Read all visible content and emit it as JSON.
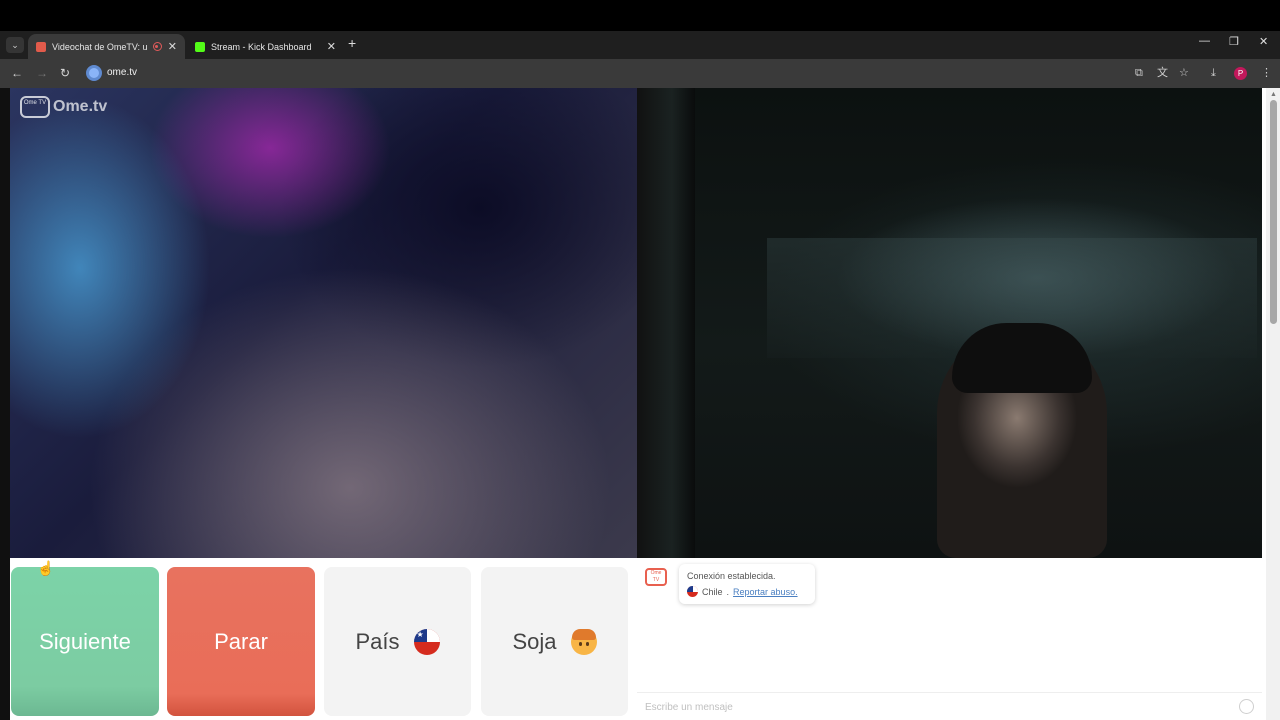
{
  "browser": {
    "tabs": [
      {
        "title": "Videochat de OmeTV: unu",
        "favicon_color": "#e25b4b",
        "recording": true,
        "active": true
      },
      {
        "title": "Stream - Kick Dashboard",
        "favicon_color": "#53fc18",
        "active": false
      }
    ],
    "url": "ome.tv",
    "profile_initial": "P"
  },
  "logo": {
    "text": "Ome.tv",
    "tv_text": "Ome TV"
  },
  "buttons": {
    "next": "Siguiente",
    "stop": "Parar",
    "country": "País",
    "gender": "Soja"
  },
  "chat": {
    "status": "Conexión establecida.",
    "country": "Chile",
    "separator": ".",
    "report": "Reportar abuso.",
    "input_placeholder": "Escribe un mensaje"
  },
  "icons": {
    "country_flag": "chile-flag-icon",
    "gender": "boy-emoji-icon",
    "accent_next": "#7cd3a8",
    "accent_stop": "#e96d58"
  }
}
